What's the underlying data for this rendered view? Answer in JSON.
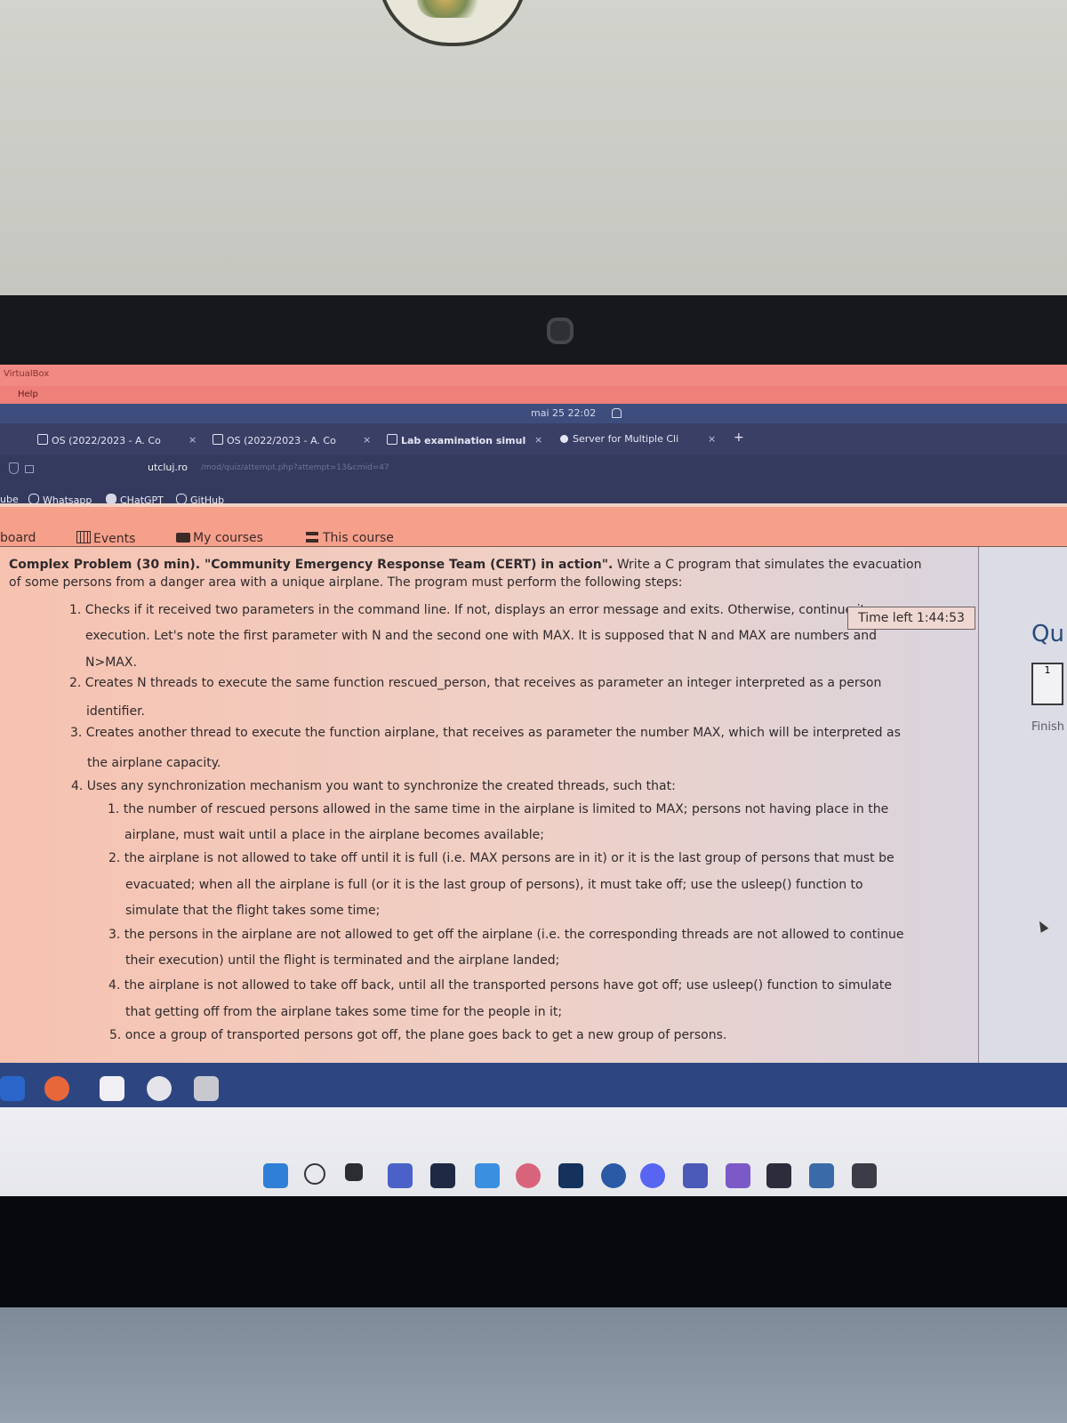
{
  "virtualbox": {
    "title": "VirtualBox",
    "menu_help": "Help"
  },
  "system": {
    "clock": "mai 25  22:02"
  },
  "browser": {
    "tabs": [
      {
        "label": "OS (2022/2023 - A. Co"
      },
      {
        "label": "OS (2022/2023 - A. Co"
      },
      {
        "label": "Lab examination simul"
      },
      {
        "label": "Server for Multiple Cli"
      }
    ],
    "tab_close": "×",
    "new_tab": "+",
    "url_domain": "utcluj.ro",
    "url_path": "/mod/quiz/attempt.php?attempt=13&cmid=47",
    "bookmarks": [
      {
        "label": "ube"
      },
      {
        "label": "Whatsapp"
      },
      {
        "label": "CHatGPT"
      },
      {
        "label": "GitHub"
      }
    ]
  },
  "moodle_nav": {
    "items": [
      {
        "label": "board"
      },
      {
        "label": "Events"
      },
      {
        "label": "My courses"
      },
      {
        "label": "This course"
      }
    ]
  },
  "quiz": {
    "timer": "Time left 1:44:53",
    "sidebar_heading": "Qu",
    "question_number": "1",
    "finish_label": "Finish",
    "problem_title": "Complex Problem (30 min). \"Community Emergency Response Team (CERT) in action\".",
    "problem_intro": " Write a C program that simulates the evacuation of some persons from a danger area with a unique airplane. The program must perform the following steps:",
    "steps": [
      {
        "line1": "1. Checks if it received two parameters in the command line. If not, displays an error message and exits. Otherwise, continue its",
        "line2": "execution. Let's note the first parameter with N and the second one with MAX. It is supposed that N and MAX are numbers and",
        "line3": "N>MAX."
      },
      {
        "line1": "2. Creates N threads to execute the same function rescued_person, that receives as parameter an integer interpreted as a person",
        "line2": "identifier."
      },
      {
        "line1": "3. Creates another thread to execute the function airplane, that receives as parameter the number MAX, which will be interpreted as",
        "line2": "the airplane capacity."
      },
      {
        "line1": "4. Uses any synchronization mechanism you want to synchronize the created threads, such that:"
      }
    ],
    "substeps": [
      {
        "line1": "1. the number of rescued persons allowed in the same time in the airplane is limited to MAX; persons not having place in the",
        "line2": "airplane, must wait until a place in the airplane becomes available;"
      },
      {
        "line1": "2. the airplane is not allowed to take off until it is full (i.e. MAX persons are in it) or it is the last group of persons that must be",
        "line2": "evacuated; when all the airplane is full (or it is the last group of persons), it must take off; use the usleep() function to",
        "line3": "simulate that the flight takes some time;"
      },
      {
        "line1": "3. the persons in the airplane are not allowed to get off the airplane (i.e. the corresponding threads are not allowed to continue",
        "line2": "their execution) until the flight is terminated and the airplane landed;"
      },
      {
        "line1": "4. the airplane is not allowed to take off back, until all the transported persons have got off; use usleep() function to simulate",
        "line2": "that getting off from the airplane takes some time for the people in it;"
      },
      {
        "line1": "5. once a group of transported persons got off, the plane goes back to get a new group of persons."
      }
    ]
  },
  "colors": {
    "nav_bg": "#f6a08c",
    "tabbar_bg": "#3a3f66",
    "dock_bg": "#2d4682",
    "accent": "#274a7a"
  }
}
